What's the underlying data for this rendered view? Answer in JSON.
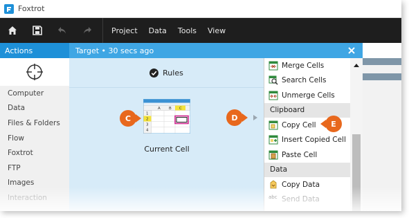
{
  "app": {
    "title": "Foxtrot"
  },
  "toolbar": {
    "icons": [
      "home-icon",
      "save-icon",
      "undo-icon",
      "redo-icon"
    ],
    "menu": [
      "Project",
      "Data",
      "Tools",
      "View"
    ]
  },
  "actions_panel": {
    "title": "Actions",
    "icon": "crosshair-icon",
    "categories": [
      "Computer",
      "Data",
      "Files & Folders",
      "Flow",
      "Foxtrot",
      "FTP",
      "Images",
      "Interaction"
    ]
  },
  "target_panel": {
    "header": "Target  •  30 secs ago",
    "rules_label": "Rules",
    "current_cell_label": "Current Cell",
    "thumbnail": {
      "columns": [
        "A",
        "B",
        "C"
      ],
      "rows": [
        "1",
        "2",
        "3",
        "4"
      ]
    }
  },
  "callouts": {
    "c": "C",
    "d": "D",
    "e": "E"
  },
  "dropdown": {
    "items_top": [
      {
        "label": "Merge Cells",
        "icon": "merge-cells-icon"
      },
      {
        "label": "Search Cells",
        "icon": "search-cells-icon"
      },
      {
        "label": "Unmerge Cells",
        "icon": "unmerge-cells-icon"
      }
    ],
    "section_clipboard": "Clipboard",
    "items_clipboard": [
      {
        "label": "Copy Cell",
        "icon": "copy-cell-icon"
      },
      {
        "label": "Insert Copied Cell",
        "icon": "insert-copied-cell-icon"
      },
      {
        "label": "Paste Cell",
        "icon": "paste-cell-icon"
      }
    ],
    "section_data": "Data",
    "items_data": [
      {
        "label": "Copy Data",
        "icon": "copy-data-icon"
      },
      {
        "label": "Send Data",
        "icon": "send-data-icon"
      }
    ],
    "send_data_icon_text": "abc"
  },
  "colors": {
    "accent": "#1e90d8",
    "target_header": "#3fa6e4",
    "target_body": "#d7ebf8",
    "callout": "#e8681d",
    "toolbar_bg": "#1e1e1e"
  }
}
